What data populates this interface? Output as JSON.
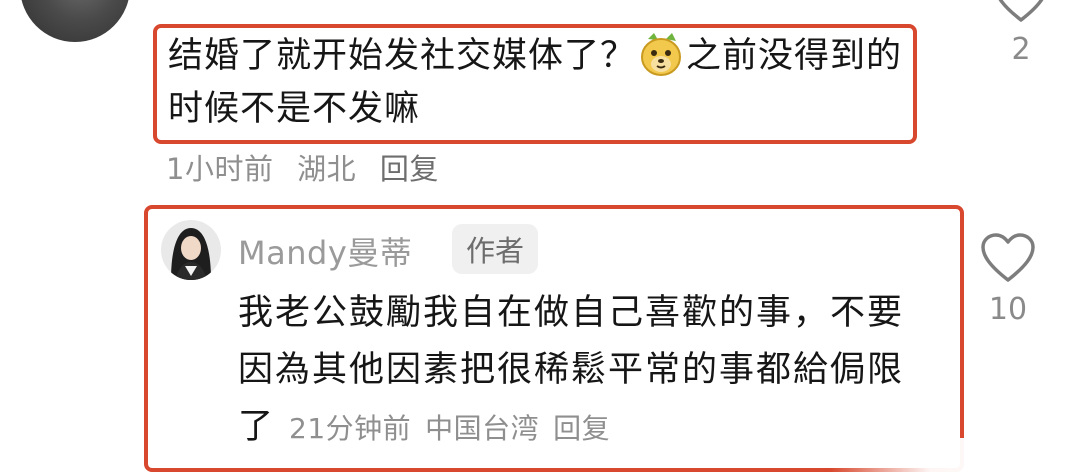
{
  "comment": {
    "text_before_emoji": "结婚了就开始发社交媒体了？",
    "emoji": "mango-face-emoji",
    "text_after_emoji": "之前没得到的时候不是不发嘛",
    "time": "1小时前",
    "location": "湖北",
    "reply_label": "回复",
    "like_count": "2"
  },
  "reply": {
    "author": "Mandy曼蒂",
    "badge": "作者",
    "text": "我老公鼓勵我自在做自己喜歡的事，不要因為其他因素把很稀鬆平常的事都給侷限了",
    "time": "21分钟前",
    "location": "中国台湾",
    "reply_label": "回复",
    "like_count": "10"
  },
  "colors": {
    "highlight": "#d8482e",
    "text": "#161616",
    "meta": "#8f8f8f"
  }
}
